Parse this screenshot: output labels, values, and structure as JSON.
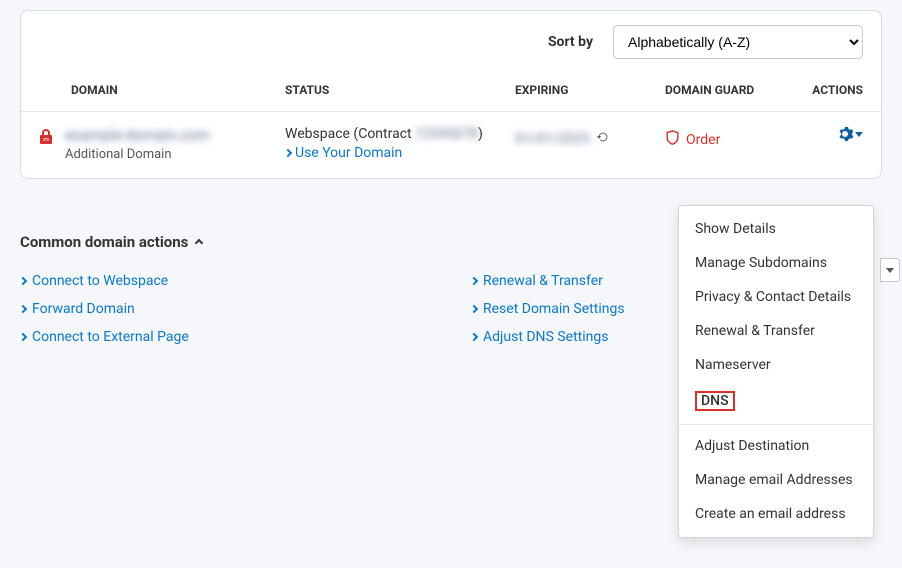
{
  "sort": {
    "label": "Sort by",
    "selected": "Alphabetically (A-Z)"
  },
  "columns": {
    "domain": "DOMAIN",
    "status": "STATUS",
    "expiring": "EXPIRING",
    "guard": "DOMAIN GUARD",
    "actions": "ACTIONS"
  },
  "row": {
    "domain_name": "example-domain.com",
    "domain_type": "Additional Domain",
    "status_prefix": "Webspace (Contract ",
    "status_blurred": "12345678",
    "status_suffix": ")",
    "use_domain": "Use Your Domain",
    "expiring": "01/01/2025",
    "guard": "Order"
  },
  "dropdown": {
    "items_a": [
      "Show Details",
      "Manage Subdomains",
      "Privacy & Contact Details",
      "Renewal & Transfer",
      "Nameserver"
    ],
    "dns": "DNS",
    "items_b": [
      "Adjust Destination",
      "Manage email Addresses",
      "Create an email address"
    ]
  },
  "common": {
    "title": "Common domain actions",
    "left": [
      "Connect to Webspace",
      "Forward Domain",
      "Connect to External Page"
    ],
    "right": [
      "Renewal & Transfer",
      "Reset Domain Settings",
      "Adjust DNS Settings"
    ]
  }
}
